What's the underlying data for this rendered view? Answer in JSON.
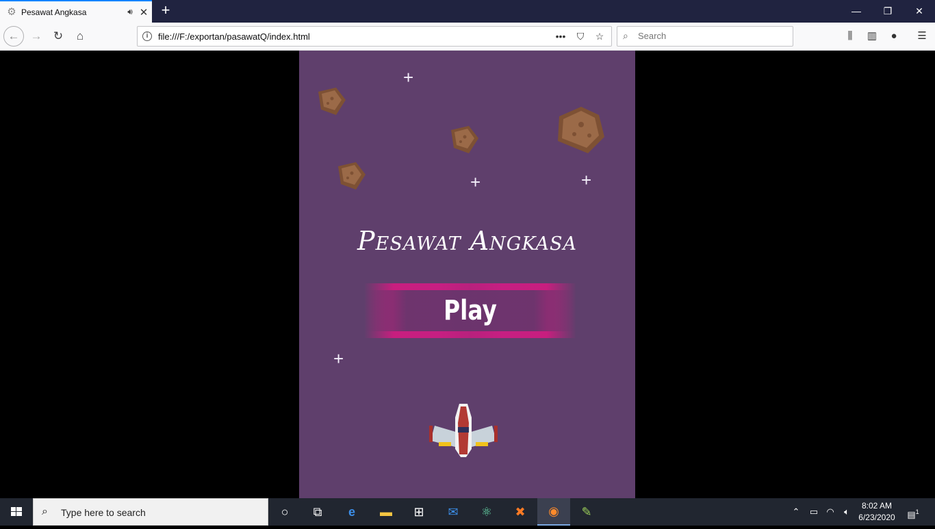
{
  "browser": {
    "tab": {
      "title": "Pesawat Angkasa",
      "favicon": "gear-icon",
      "audio_icon": "speaker-icon",
      "close_icon": "close-icon"
    },
    "new_tab_label": "+",
    "window_controls": [
      "minimize-icon",
      "restore-icon",
      "close-icon"
    ],
    "url": "file:///F:/exportan/pasawatQ/index.html",
    "search_placeholder": "Search",
    "colors": {
      "tabbar": "#202340",
      "accent": "#0a84ff"
    }
  },
  "game": {
    "title": "Pesawat Angkasa",
    "play_label": "Play",
    "colors": {
      "background": "#5f3f6c",
      "button": "#d11b82",
      "rock": "#7e5134"
    }
  },
  "taskbar": {
    "search_placeholder": "Type here to search",
    "apps": [
      "task-view-icon",
      "edge-icon",
      "file-explorer-icon",
      "store-icon",
      "mail-icon",
      "atom-icon",
      "xampp-icon",
      "firefox-icon",
      "notepad-plus-icon"
    ],
    "time": "8:02 AM",
    "date": "6/23/2020",
    "notification_count": "1"
  }
}
